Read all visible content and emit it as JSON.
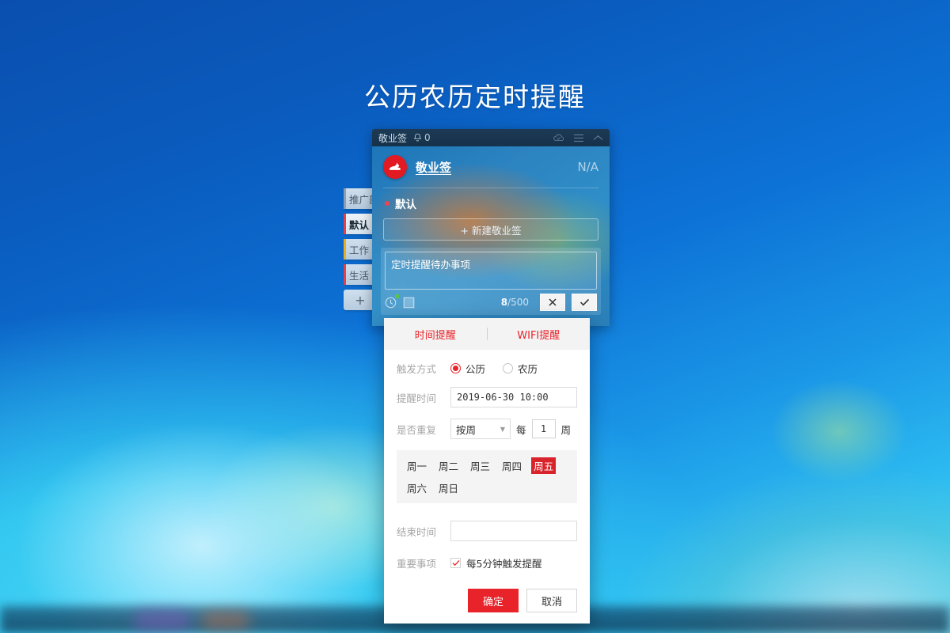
{
  "page": {
    "title": "公历农历定时提醒"
  },
  "sidebar": {
    "items": [
      {
        "label": "推广部",
        "color": "#8aa0b2",
        "active": false
      },
      {
        "label": "默认",
        "color": "#e0424f",
        "active": true
      },
      {
        "label": "工作",
        "color": "#e8b020",
        "active": false
      },
      {
        "label": "生活",
        "color": "#e0424f",
        "active": false
      }
    ],
    "add_label": "+"
  },
  "titlebar": {
    "app_name": "敬业签",
    "bell_icon": "bell-icon",
    "notification_count": "0",
    "cloud_icon": "cloud-sync-icon",
    "menu_icon": "hamburger-menu-icon",
    "collapse_icon": "chevron-up-icon"
  },
  "app": {
    "brand": "敬业签",
    "account_status": "N/A",
    "group_name": "默认",
    "new_note_label": "+ 新建敬业签",
    "note": {
      "content": "定时提醒待办事项",
      "char_used": "8",
      "char_limit": "/500",
      "clock_icon": "clock-reminder-icon",
      "checkbox_icon": "checkbox-icon",
      "cancel_icon": "close-x-icon",
      "confirm_icon": "checkmark-icon"
    }
  },
  "dialog": {
    "tabs": [
      {
        "label": "时间提醒",
        "active": true
      },
      {
        "label": "WIFI提醒",
        "active": false
      }
    ],
    "trigger_type": {
      "label": "触发方式",
      "options": [
        {
          "label": "公历",
          "selected": true
        },
        {
          "label": "农历",
          "selected": false
        }
      ]
    },
    "remind_time": {
      "label": "提醒时间",
      "value": "2019-06-30 10:00"
    },
    "repeat": {
      "label": "是否重复",
      "mode": "按周",
      "caret_icon": "chevron-down-icon",
      "every_prefix": "每",
      "interval": "1",
      "unit": "周"
    },
    "weekdays": {
      "days": [
        {
          "label": "周一",
          "selected": false
        },
        {
          "label": "周二",
          "selected": false
        },
        {
          "label": "周三",
          "selected": false
        },
        {
          "label": "周四",
          "selected": false
        },
        {
          "label": "周五",
          "selected": true
        },
        {
          "label": "周六",
          "selected": false
        },
        {
          "label": "周日",
          "selected": false
        }
      ]
    },
    "end_time": {
      "label": "结束时间",
      "value": "",
      "placeholder": ""
    },
    "important": {
      "label": "重要事项",
      "checked": true,
      "text": "每5分钟触发提醒",
      "check_icon": "checkmark-icon"
    },
    "actions": {
      "confirm": "确定",
      "cancel": "取消"
    },
    "accent_color": "#e8232a"
  }
}
